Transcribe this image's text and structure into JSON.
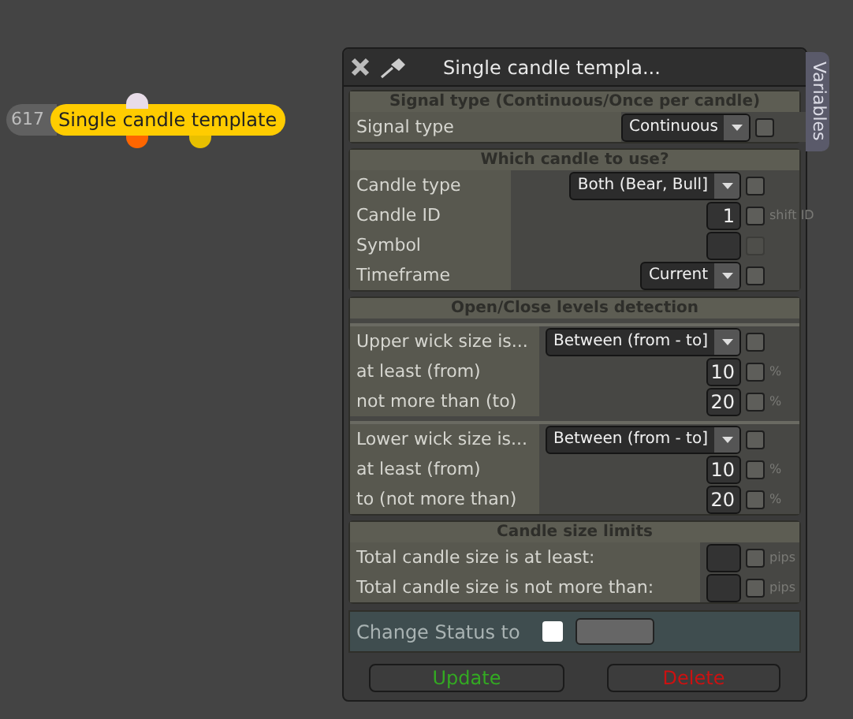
{
  "node": {
    "id_label": "617",
    "title": "Single candle template"
  },
  "dialog": {
    "title": "Single candle templa...",
    "variables_tab": "Variables",
    "sections": [
      {
        "header": "Signal type (Continuous/Once per candle)",
        "groups": [
          [
            {
              "label": "Signal type",
              "kind": "select",
              "value": "Continuous",
              "checkbox": {
                "checked": false,
                "disabled": false
              }
            }
          ]
        ]
      },
      {
        "header": "Which candle to use?",
        "groups": [
          [
            {
              "label": "Candle type",
              "kind": "select",
              "value": "Both (Bear, Bull]",
              "checkbox": {
                "checked": false,
                "disabled": false
              }
            },
            {
              "label": "Candle ID",
              "kind": "number",
              "value": "1",
              "checkbox": {
                "checked": false,
                "disabled": false
              },
              "unit": "shift ID"
            },
            {
              "label": "Symbol",
              "kind": "number",
              "checkbox": {
                "checked": false,
                "disabled": true
              }
            },
            {
              "label": "Timeframe",
              "kind": "select",
              "value": "Current",
              "checkbox": {
                "checked": false,
                "disabled": false
              }
            }
          ]
        ]
      },
      {
        "header": "Open/Close levels detection",
        "groups": [
          [
            {
              "label": "Upper wick size is...",
              "kind": "select",
              "value": "Between (from - to]",
              "checkbox": {
                "checked": false,
                "disabled": false
              }
            },
            {
              "label": "at least (from)",
              "kind": "number",
              "value": "10",
              "checkbox": {
                "checked": false,
                "disabled": false
              },
              "unit": "%"
            },
            {
              "label": "not more than (to)",
              "kind": "number",
              "value": "20",
              "checkbox": {
                "checked": false,
                "disabled": false
              },
              "unit": "%"
            }
          ],
          [
            {
              "label": "Lower wick size is...",
              "kind": "select",
              "value": "Between (from - to]",
              "checkbox": {
                "checked": false,
                "disabled": false
              }
            },
            {
              "label": "at least (from)",
              "kind": "number",
              "value": "10",
              "checkbox": {
                "checked": false,
                "disabled": false
              },
              "unit": "%"
            },
            {
              "label": "to (not more than)",
              "kind": "number",
              "value": "20",
              "checkbox": {
                "checked": false,
                "disabled": false
              },
              "unit": "%"
            }
          ]
        ]
      },
      {
        "header": "Candle size limits",
        "groups": [
          [
            {
              "label": "Total candle size is at least:",
              "kind": "number",
              "checkbox": {
                "checked": false,
                "disabled": false
              },
              "unit": "pips"
            },
            {
              "label": "Total candle size is not more than:",
              "kind": "number",
              "checkbox": {
                "checked": false,
                "disabled": false
              },
              "unit": "pips"
            }
          ]
        ]
      }
    ],
    "status": {
      "label": "Change Status to",
      "checked": false
    },
    "buttons": [
      {
        "label": "Update",
        "kind": "update"
      },
      {
        "label": "Delete",
        "kind": "delete"
      }
    ]
  }
}
